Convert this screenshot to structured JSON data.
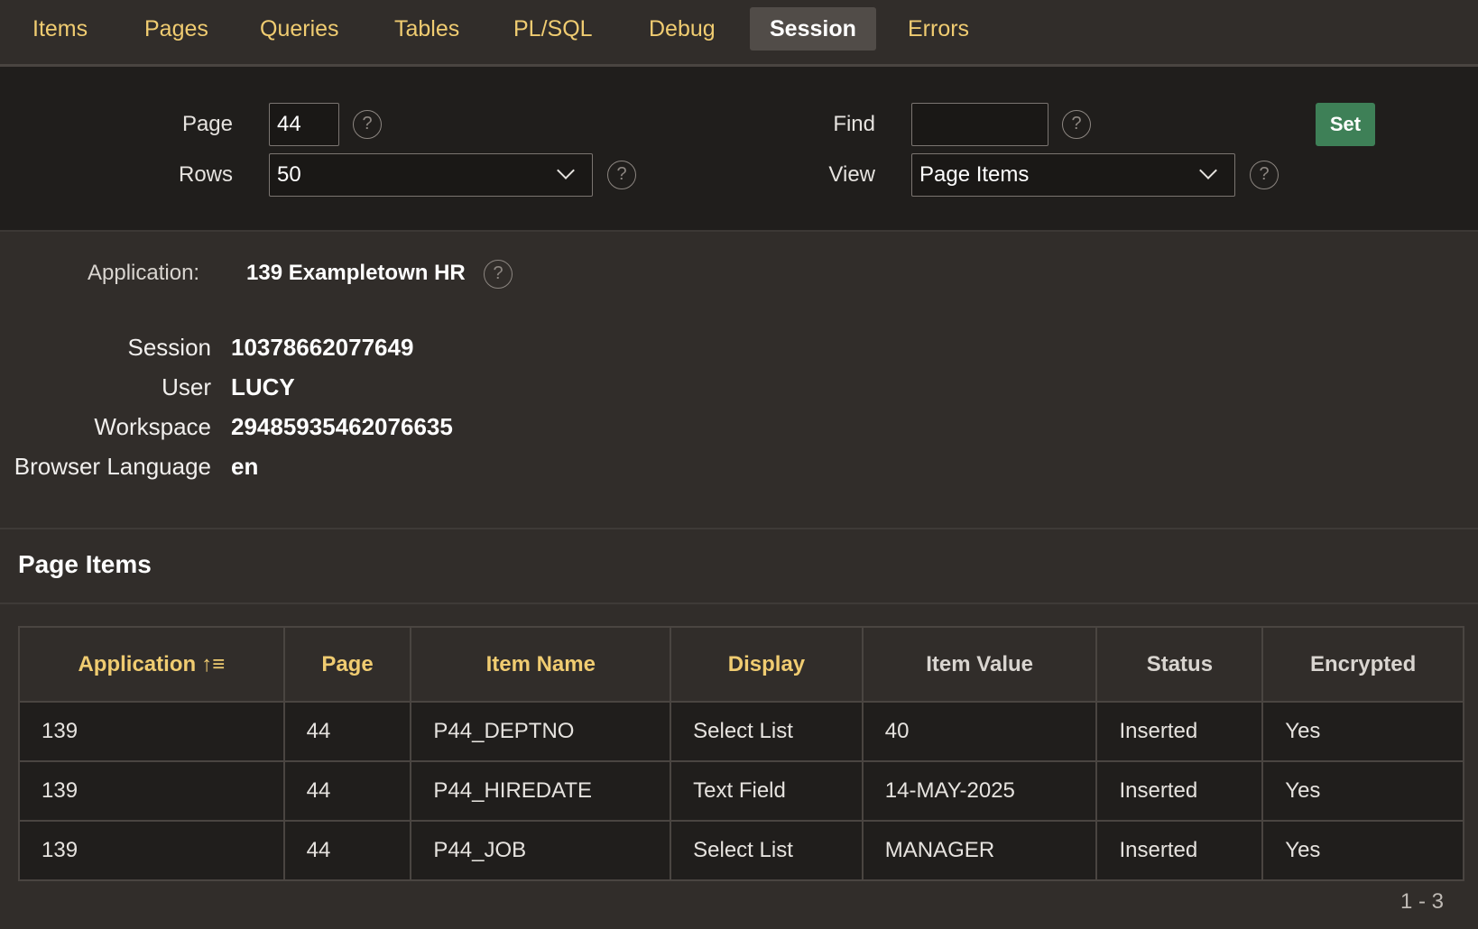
{
  "tabs": [
    {
      "label": "Items"
    },
    {
      "label": "Pages"
    },
    {
      "label": "Queries"
    },
    {
      "label": "Tables"
    },
    {
      "label": "PL/SQL"
    },
    {
      "label": "Debug"
    },
    {
      "label": "Session",
      "active": true
    },
    {
      "label": "Errors"
    }
  ],
  "filter": {
    "page_label": "Page",
    "page_value": "44",
    "rows_label": "Rows",
    "rows_value": "50",
    "find_label": "Find",
    "find_value": "",
    "view_label": "View",
    "view_value": "Page Items",
    "set_label": "Set",
    "help_glyph": "?"
  },
  "application": {
    "label": "Application:",
    "value": "139 Exampletown HR"
  },
  "session_info": {
    "session_label": "Session",
    "session_value": "10378662077649",
    "user_label": "User",
    "user_value": "LUCY",
    "workspace_label": "Workspace",
    "workspace_value": "29485935462076635",
    "language_label": "Browser Language",
    "language_value": "en"
  },
  "region": {
    "title": "Page Items"
  },
  "table": {
    "headers": [
      "Application",
      "Page",
      "Item Name",
      "Display",
      "Item Value",
      "Status",
      "Encrypted"
    ],
    "rows": [
      [
        "139",
        "44",
        "P44_DEPTNO",
        "Select List",
        "40",
        "Inserted",
        "Yes"
      ],
      [
        "139",
        "44",
        "P44_HIREDATE",
        "Text Field",
        "14-MAY-2025",
        "Inserted",
        "Yes"
      ],
      [
        "139",
        "44",
        "P44_JOB",
        "Select List",
        "MANAGER",
        "Inserted",
        "Yes"
      ]
    ],
    "pagination": "1 - 3"
  },
  "colors": {
    "accent_text": "#f0cc71",
    "set_button": "#3e8057",
    "background": "#312d2a",
    "panel": "#201e1c"
  }
}
